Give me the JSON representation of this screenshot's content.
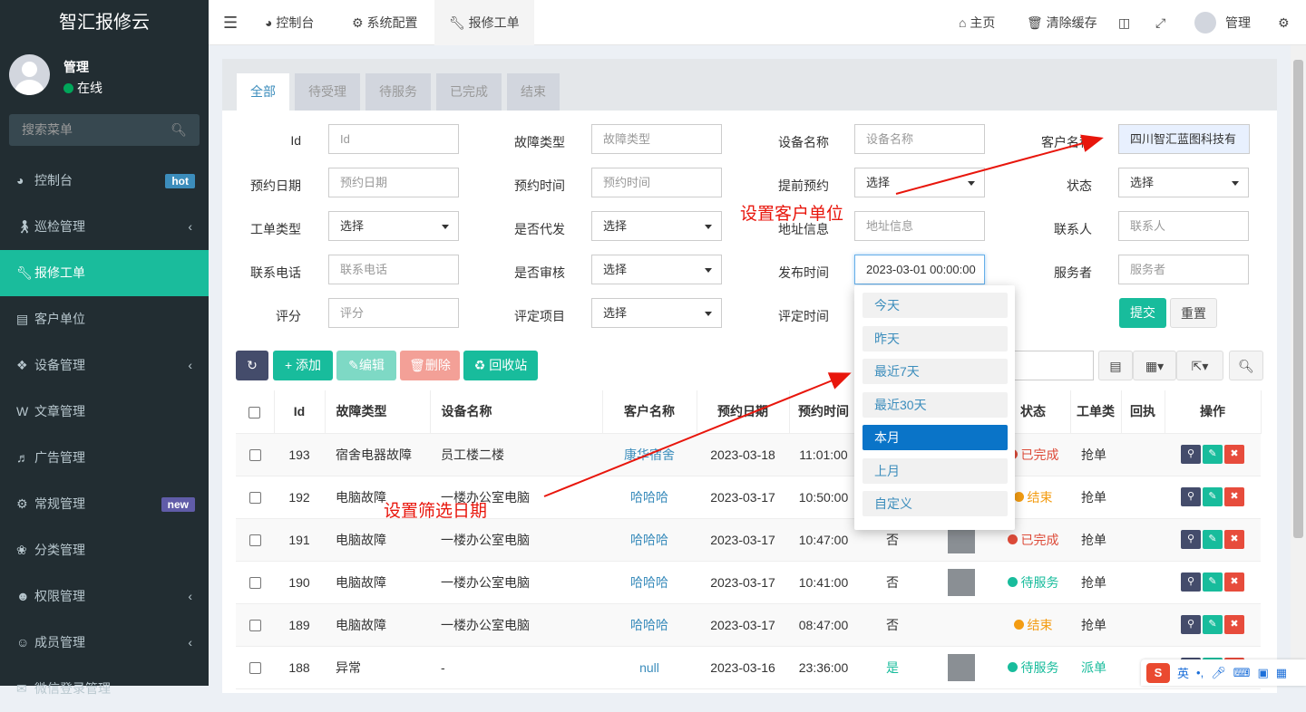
{
  "sidebar": {
    "logo": "智汇报修云",
    "user": {
      "name": "管理",
      "status": "在线"
    },
    "search_placeholder": "搜索菜单",
    "items": [
      {
        "label": "控制台",
        "icon": "dashboard-icon",
        "badge": "hot"
      },
      {
        "label": "巡检管理",
        "icon": "walk-icon"
      },
      {
        "label": "报修工单",
        "icon": "wrench-icon",
        "active": true
      },
      {
        "label": "客户单位",
        "icon": "contact-card-icon"
      },
      {
        "label": "设备管理",
        "icon": "cubes-icon"
      },
      {
        "label": "文章管理",
        "icon": "wordpress-icon"
      },
      {
        "label": "广告管理",
        "icon": "volume-icon"
      },
      {
        "label": "常规管理",
        "icon": "cogs-icon",
        "badge": "new"
      },
      {
        "label": "分类管理",
        "icon": "leaf-icon"
      },
      {
        "label": "权限管理",
        "icon": "group-icon"
      },
      {
        "label": "成员管理",
        "icon": "user-circle-icon"
      },
      {
        "label": "微信登录管理",
        "icon": "wechat-icon"
      }
    ]
  },
  "topbar": {
    "tabs": [
      "控制台",
      "系统配置",
      "报修工单"
    ],
    "home": "主页",
    "clear_cache": "清除缓存",
    "username": "管理"
  },
  "status_tabs": [
    "全部",
    "待受理",
    "待服务",
    "已完成",
    "结束"
  ],
  "form": {
    "id_label": "Id",
    "id_ph": "Id",
    "fault_label": "故障类型",
    "fault_ph": "故障类型",
    "device_label": "设备名称",
    "device_ph": "设备名称",
    "customer_label": "客户名称",
    "customer_value": "四川智汇蓝图科技有",
    "resv_date_label": "预约日期",
    "resv_date_ph": "预约日期",
    "resv_time_label": "预约时间",
    "resv_time_ph": "预约时间",
    "advance_label": "提前预约",
    "select_ph": "选择",
    "status_label": "状态",
    "order_type_label": "工单类型",
    "proxy_label": "是否代发",
    "address_label": "地址信息",
    "address_ph": "地址信息",
    "contact_label": "联系人",
    "contact_ph": "联系人",
    "phone_label": "联系电话",
    "phone_ph": "联系电话",
    "audit_label": "是否审核",
    "publish_label": "发布时间",
    "publish_value": "2023-03-01 00:00:00",
    "server_label": "服务者",
    "server_ph": "服务者",
    "rate_label": "评分",
    "rate_ph": "评分",
    "rate_item_label": "评定项目",
    "rate_time_label": "评定时间",
    "submit": "提交",
    "reset": "重置"
  },
  "date_dropdown": [
    "今天",
    "昨天",
    "最近7天",
    "最近30天",
    "本月",
    "上月",
    "自定义"
  ],
  "toolbar": {
    "add": "添加",
    "edit": "编辑",
    "delete": "删除",
    "recycle": "回收站"
  },
  "annotations": {
    "customer": "设置客户单位",
    "date": "设置筛选日期"
  },
  "table": {
    "headers": [
      "Id",
      "故障类型",
      "设备名称",
      "客户名称",
      "预约日期",
      "预约时间",
      "",
      "",
      "状态",
      "工单类",
      "回执",
      "操作"
    ],
    "rows": [
      {
        "id": "193",
        "fault": "宿舍电器故障",
        "device": "员工楼二楼",
        "customer": "康华宿舍",
        "date": "2023-03-18",
        "time": "11:01:00",
        "advance": "",
        "img": false,
        "status": "已完成",
        "status_color": "#dd4b39",
        "type": "抢单"
      },
      {
        "id": "192",
        "fault": "电脑故障",
        "device": "一楼办公室电脑",
        "customer": "哈哈哈",
        "date": "2023-03-17",
        "time": "10:50:00",
        "advance": "",
        "img": false,
        "status": "结束",
        "status_color": "#f39c12",
        "type": "抢单"
      },
      {
        "id": "191",
        "fault": "电脑故障",
        "device": "一楼办公室电脑",
        "customer": "哈哈哈",
        "date": "2023-03-17",
        "time": "10:47:00",
        "advance": "否",
        "img": true,
        "status": "已完成",
        "status_color": "#dd4b39",
        "type": "抢单"
      },
      {
        "id": "190",
        "fault": "电脑故障",
        "device": "一楼办公室电脑",
        "customer": "哈哈哈",
        "date": "2023-03-17",
        "time": "10:41:00",
        "advance": "否",
        "img": true,
        "status": "待服务",
        "status_color": "#18bc9c",
        "type": "抢单"
      },
      {
        "id": "189",
        "fault": "电脑故障",
        "device": "一楼办公室电脑",
        "customer": "哈哈哈",
        "date": "2023-03-17",
        "time": "08:47:00",
        "advance": "否",
        "img": false,
        "status": "结束",
        "status_color": "#f39c12",
        "type": "抢单"
      },
      {
        "id": "188",
        "fault": "异常",
        "device": "-",
        "customer": "null",
        "date": "2023-03-16",
        "time": "23:36:00",
        "advance": "是",
        "img": true,
        "status": "待服务",
        "status_color": "#18bc9c",
        "type": "派单"
      }
    ]
  },
  "colors": {
    "sidebar_bg": "#222d32",
    "accent": "#1abc9c",
    "link": "#3c8dbc",
    "danger": "#e74c3c",
    "dark": "#444c6b"
  }
}
